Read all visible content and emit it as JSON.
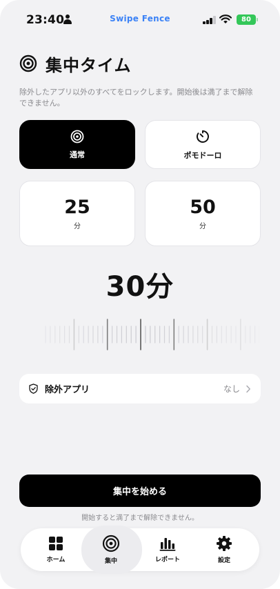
{
  "status_bar": {
    "time": "23:40",
    "app_brand": "Swipe Fence",
    "battery": "80"
  },
  "header": {
    "title": "集中タイム",
    "description": "除外したアプリ以外のすべてをロックします。開始後は満了まで解除できません。"
  },
  "modes": [
    {
      "label": "通常",
      "icon": "target-icon",
      "selected": true
    },
    {
      "label": "ポモドーロ",
      "icon": "timer-icon",
      "selected": false
    }
  ],
  "presets": [
    {
      "value": "25",
      "unit": "分"
    },
    {
      "value": "50",
      "unit": "分"
    }
  ],
  "duration": {
    "display": "30分",
    "minutes": 30
  },
  "excluded_apps": {
    "label": "除外アプリ",
    "value": "なし"
  },
  "start_button": {
    "label": "集中を始める",
    "note": "開始すると満了まで解除できません。"
  },
  "tabs": [
    {
      "label": "ホーム",
      "icon": "grid-icon",
      "active": false
    },
    {
      "label": "集中",
      "icon": "target-icon",
      "active": true
    },
    {
      "label": "レポート",
      "icon": "bar-chart-icon",
      "active": false
    },
    {
      "label": "設定",
      "icon": "gear-icon",
      "active": false
    }
  ],
  "colors": {
    "accent": "#000000",
    "brand": "#3b82f6",
    "battery": "#34c759",
    "background": "#f2f2f4"
  }
}
